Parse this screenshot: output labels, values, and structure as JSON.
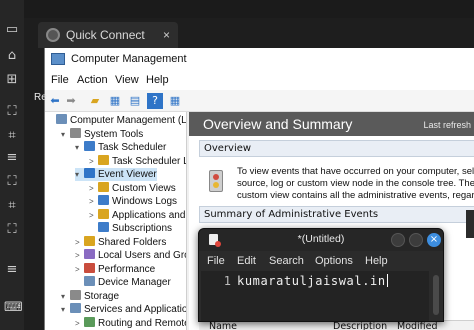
{
  "app": {
    "tab_label": "Quick Connect",
    "tab_close": "×"
  },
  "side_icons": [
    "tray-icon",
    "home-icon",
    "new-session-icon",
    "scan-icon",
    "crop-icon",
    "menu-icon",
    "monitor-icon",
    "split-icon",
    "grid-icon",
    "list-icon",
    "keyboard-icon"
  ],
  "computer_management": {
    "title": "Computer Management",
    "menu": [
      "File",
      "Action",
      "View",
      "Help"
    ],
    "left_edge_text": "Re",
    "tree": [
      {
        "label": "Computer Management (Local",
        "level": 0,
        "arrow": "",
        "selected": false
      },
      {
        "label": "System Tools",
        "level": 1,
        "arrow": "▾",
        "selected": false
      },
      {
        "label": "Task Scheduler",
        "level": 2,
        "arrow": "▾",
        "selected": false
      },
      {
        "label": "Task Scheduler Libra",
        "level": 3,
        "arrow": ">",
        "selected": false
      },
      {
        "label": "Event Viewer",
        "level": 2,
        "arrow": "▾",
        "selected": true
      },
      {
        "label": "Custom Views",
        "level": 3,
        "arrow": ">",
        "selected": false
      },
      {
        "label": "Windows Logs",
        "level": 3,
        "arrow": ">",
        "selected": false
      },
      {
        "label": "Applications and Se",
        "level": 3,
        "arrow": ">",
        "selected": false
      },
      {
        "label": "Subscriptions",
        "level": 3,
        "arrow": "",
        "selected": false
      },
      {
        "label": "Shared Folders",
        "level": 2,
        "arrow": ">",
        "selected": false
      },
      {
        "label": "Local Users and Groups",
        "level": 2,
        "arrow": ">",
        "selected": false
      },
      {
        "label": "Performance",
        "level": 2,
        "arrow": ">",
        "selected": false
      },
      {
        "label": "Device Manager",
        "level": 2,
        "arrow": "",
        "selected": false
      },
      {
        "label": "Storage",
        "level": 1,
        "arrow": "▾",
        "selected": false
      },
      {
        "label": "Services and Applications",
        "level": 1,
        "arrow": "▾",
        "selected": false
      },
      {
        "label": "Routing and Remote Ac",
        "level": 2,
        "arrow": ">",
        "selected": false
      }
    ],
    "overview": {
      "header": "Overview and Summary",
      "last_refresh": "Last refresh",
      "sub_header": "Overview",
      "text_lines": [
        "To view events that have occurred on your computer, select",
        "source, log or custom view node in the console tree. The Ad",
        "custom view contains all the administrative events, regardles"
      ],
      "summary_header": "Summary of Administrative Events",
      "columns": [
        "Name",
        "Description",
        "Modified"
      ]
    }
  },
  "editor": {
    "title": "*(Untitled)",
    "menu": [
      "File",
      "Edit",
      "Search",
      "Options",
      "Help"
    ],
    "line_number": "1",
    "line_text": "kumaratuljaiswal.in",
    "close_glyph": "×"
  }
}
